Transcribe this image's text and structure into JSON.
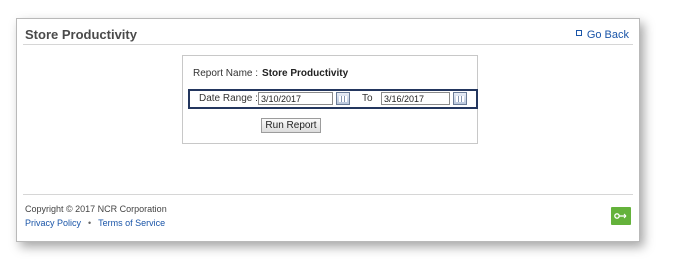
{
  "header": {
    "title": "Store Productivity",
    "go_back": "Go Back"
  },
  "report": {
    "name_label": "Report Name :",
    "name_value": "Store Productivity",
    "date_range_label": "Date Range :",
    "start_date": "3/10/2017",
    "to_label": "To",
    "end_date": "3/16/2017",
    "run_button": "Run Report"
  },
  "footer": {
    "copyright": "Copyright © 2017 NCR Corporation",
    "privacy": "Privacy Policy",
    "separator": "•",
    "terms": "Terms of Service"
  },
  "icons": {
    "go_back": "square-bullet-icon",
    "calendar": "calendar-icon",
    "logo": "ncr-logo-icon"
  },
  "colors": {
    "link": "#1a55a8",
    "highlight_border": "#23365e",
    "logo_green": "#64b23b"
  }
}
